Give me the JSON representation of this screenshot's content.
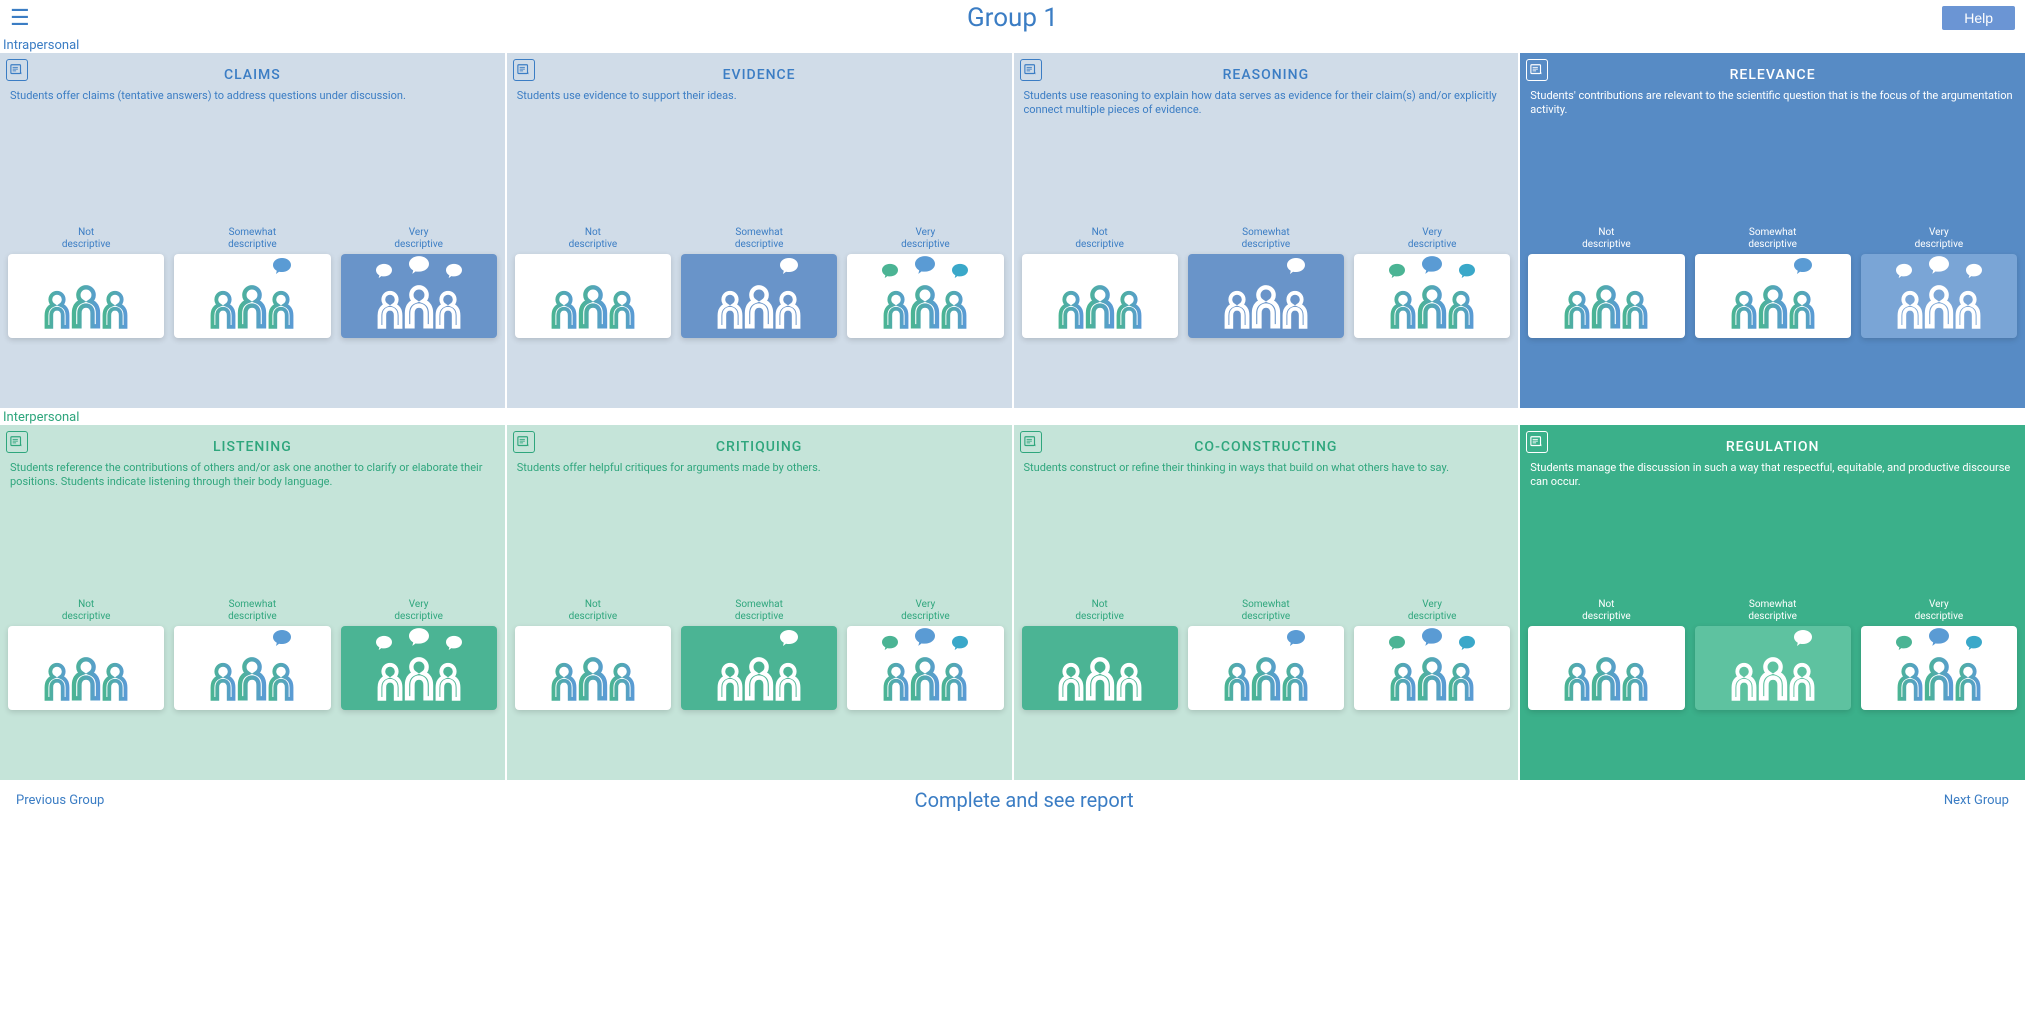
{
  "header": {
    "title": "Group 1",
    "help_label": "Help"
  },
  "sections": {
    "intrapersonal_label": "Intrapersonal",
    "interpersonal_label": "Interpersonal"
  },
  "option_labels": {
    "not": "Not\ndescriptive",
    "somewhat": "Somewhat\ndescriptive",
    "very": "Very\ndescriptive"
  },
  "cards": {
    "claims": {
      "title": "CLAIMS",
      "desc": "Students offer claims (tentative answers) to address questions under discussion.",
      "selected": "very",
      "active": false
    },
    "evidence": {
      "title": "EVIDENCE",
      "desc": "Students use evidence to support their ideas.",
      "selected": "somewhat",
      "active": false
    },
    "reasoning": {
      "title": "REASONING",
      "desc": "Students use reasoning to explain how data serves as evidence for their claim(s) and/or explicitly connect multiple pieces of evidence.",
      "selected": "somewhat",
      "active": false
    },
    "relevance": {
      "title": "RELEVANCE",
      "desc": "Students' contributions are relevant to the scientific question that is the focus of the argumentation activity.",
      "selected": "very",
      "active": true
    },
    "listening": {
      "title": "LISTENING",
      "desc": "Students reference the contributions of others and/or ask one another to clarify or elaborate their positions. Students indicate listening through their body language.",
      "selected": "very",
      "active": false
    },
    "critiquing": {
      "title": "CRITIQUING",
      "desc": "Students offer helpful critiques for arguments made by others.",
      "selected": "somewhat",
      "active": false
    },
    "coconstructing": {
      "title": "CO-CONSTRUCTING",
      "desc": "Students construct or refine their thinking in ways that build on what others have to say.",
      "selected": "not",
      "active": false
    },
    "regulation": {
      "title": "REGULATION",
      "desc": "Students manage the discussion in such a way that respectful, equitable, and productive discourse can occur.",
      "selected": "somewhat",
      "active": true
    }
  },
  "footer": {
    "prev": "Previous Group",
    "center": "Complete and see report",
    "next": "Next Group"
  },
  "colors": {
    "blue_primary": "#3b7dc4",
    "blue_card": "#d0dce8",
    "blue_active": "#578bc5",
    "green_primary": "#2fa67d",
    "green_card": "#c5e4d9",
    "green_active": "#3bb08a"
  }
}
